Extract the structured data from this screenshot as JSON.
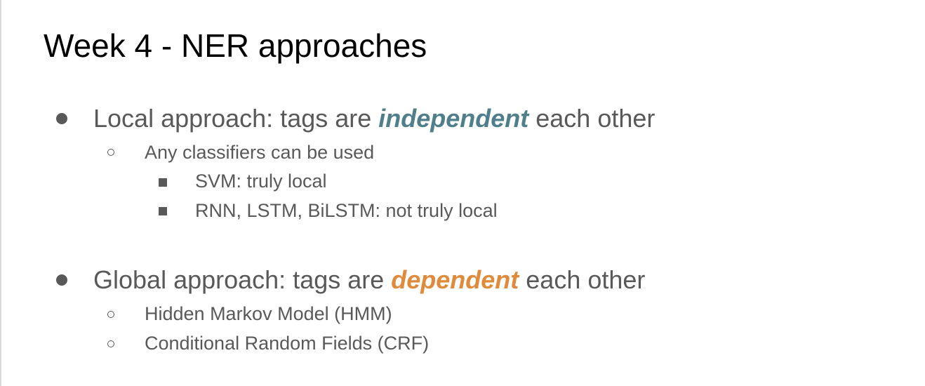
{
  "slide": {
    "title": "Week 4 - NER approaches",
    "colors": {
      "text": "#595959",
      "title": "#000000",
      "local_emphasis": "#4f7f8a",
      "global_emphasis": "#e08a3c"
    },
    "local": {
      "before": "Local approach: tags are ",
      "emphasis": "independent",
      "after": " each other",
      "sub": {
        "text": "Any classifiers can be used",
        "items": [
          "SVM: truly local",
          "RNN, LSTM, BiLSTM: not truly local"
        ]
      }
    },
    "global": {
      "before": "Global approach: tags are ",
      "emphasis": "dependent",
      "after": " each other",
      "items": [
        "Hidden Markov Model (HMM)",
        "Conditional Random Fields (CRF)"
      ]
    }
  }
}
